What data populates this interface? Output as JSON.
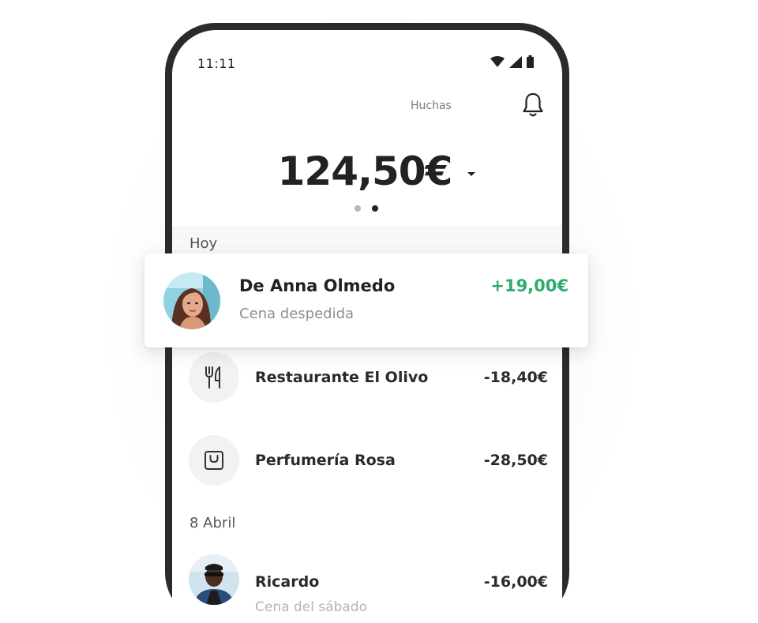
{
  "status_bar": {
    "time": "11:11"
  },
  "header": {
    "piggy_banks_label": "Huchas"
  },
  "balance": {
    "amount": "124,50€"
  },
  "sections": [
    {
      "label": "Hoy"
    },
    {
      "label": "8 Abril"
    }
  ],
  "highlight_card": {
    "title": "De Anna Olmedo",
    "subtitle": "Cena despedida",
    "amount": "+19,00€",
    "amount_color": "#2eaa6e"
  },
  "transactions": [
    {
      "title": "Restaurante El Olivo",
      "amount": "-18,40€",
      "icon": "cutlery-icon"
    },
    {
      "title": "Perfumería Rosa",
      "amount": "-28,50€",
      "icon": "shopping-bag-icon"
    },
    {
      "title": "Ricardo",
      "subtitle": "Cena del sábado",
      "amount": "-16,00€",
      "icon": "avatar"
    }
  ]
}
